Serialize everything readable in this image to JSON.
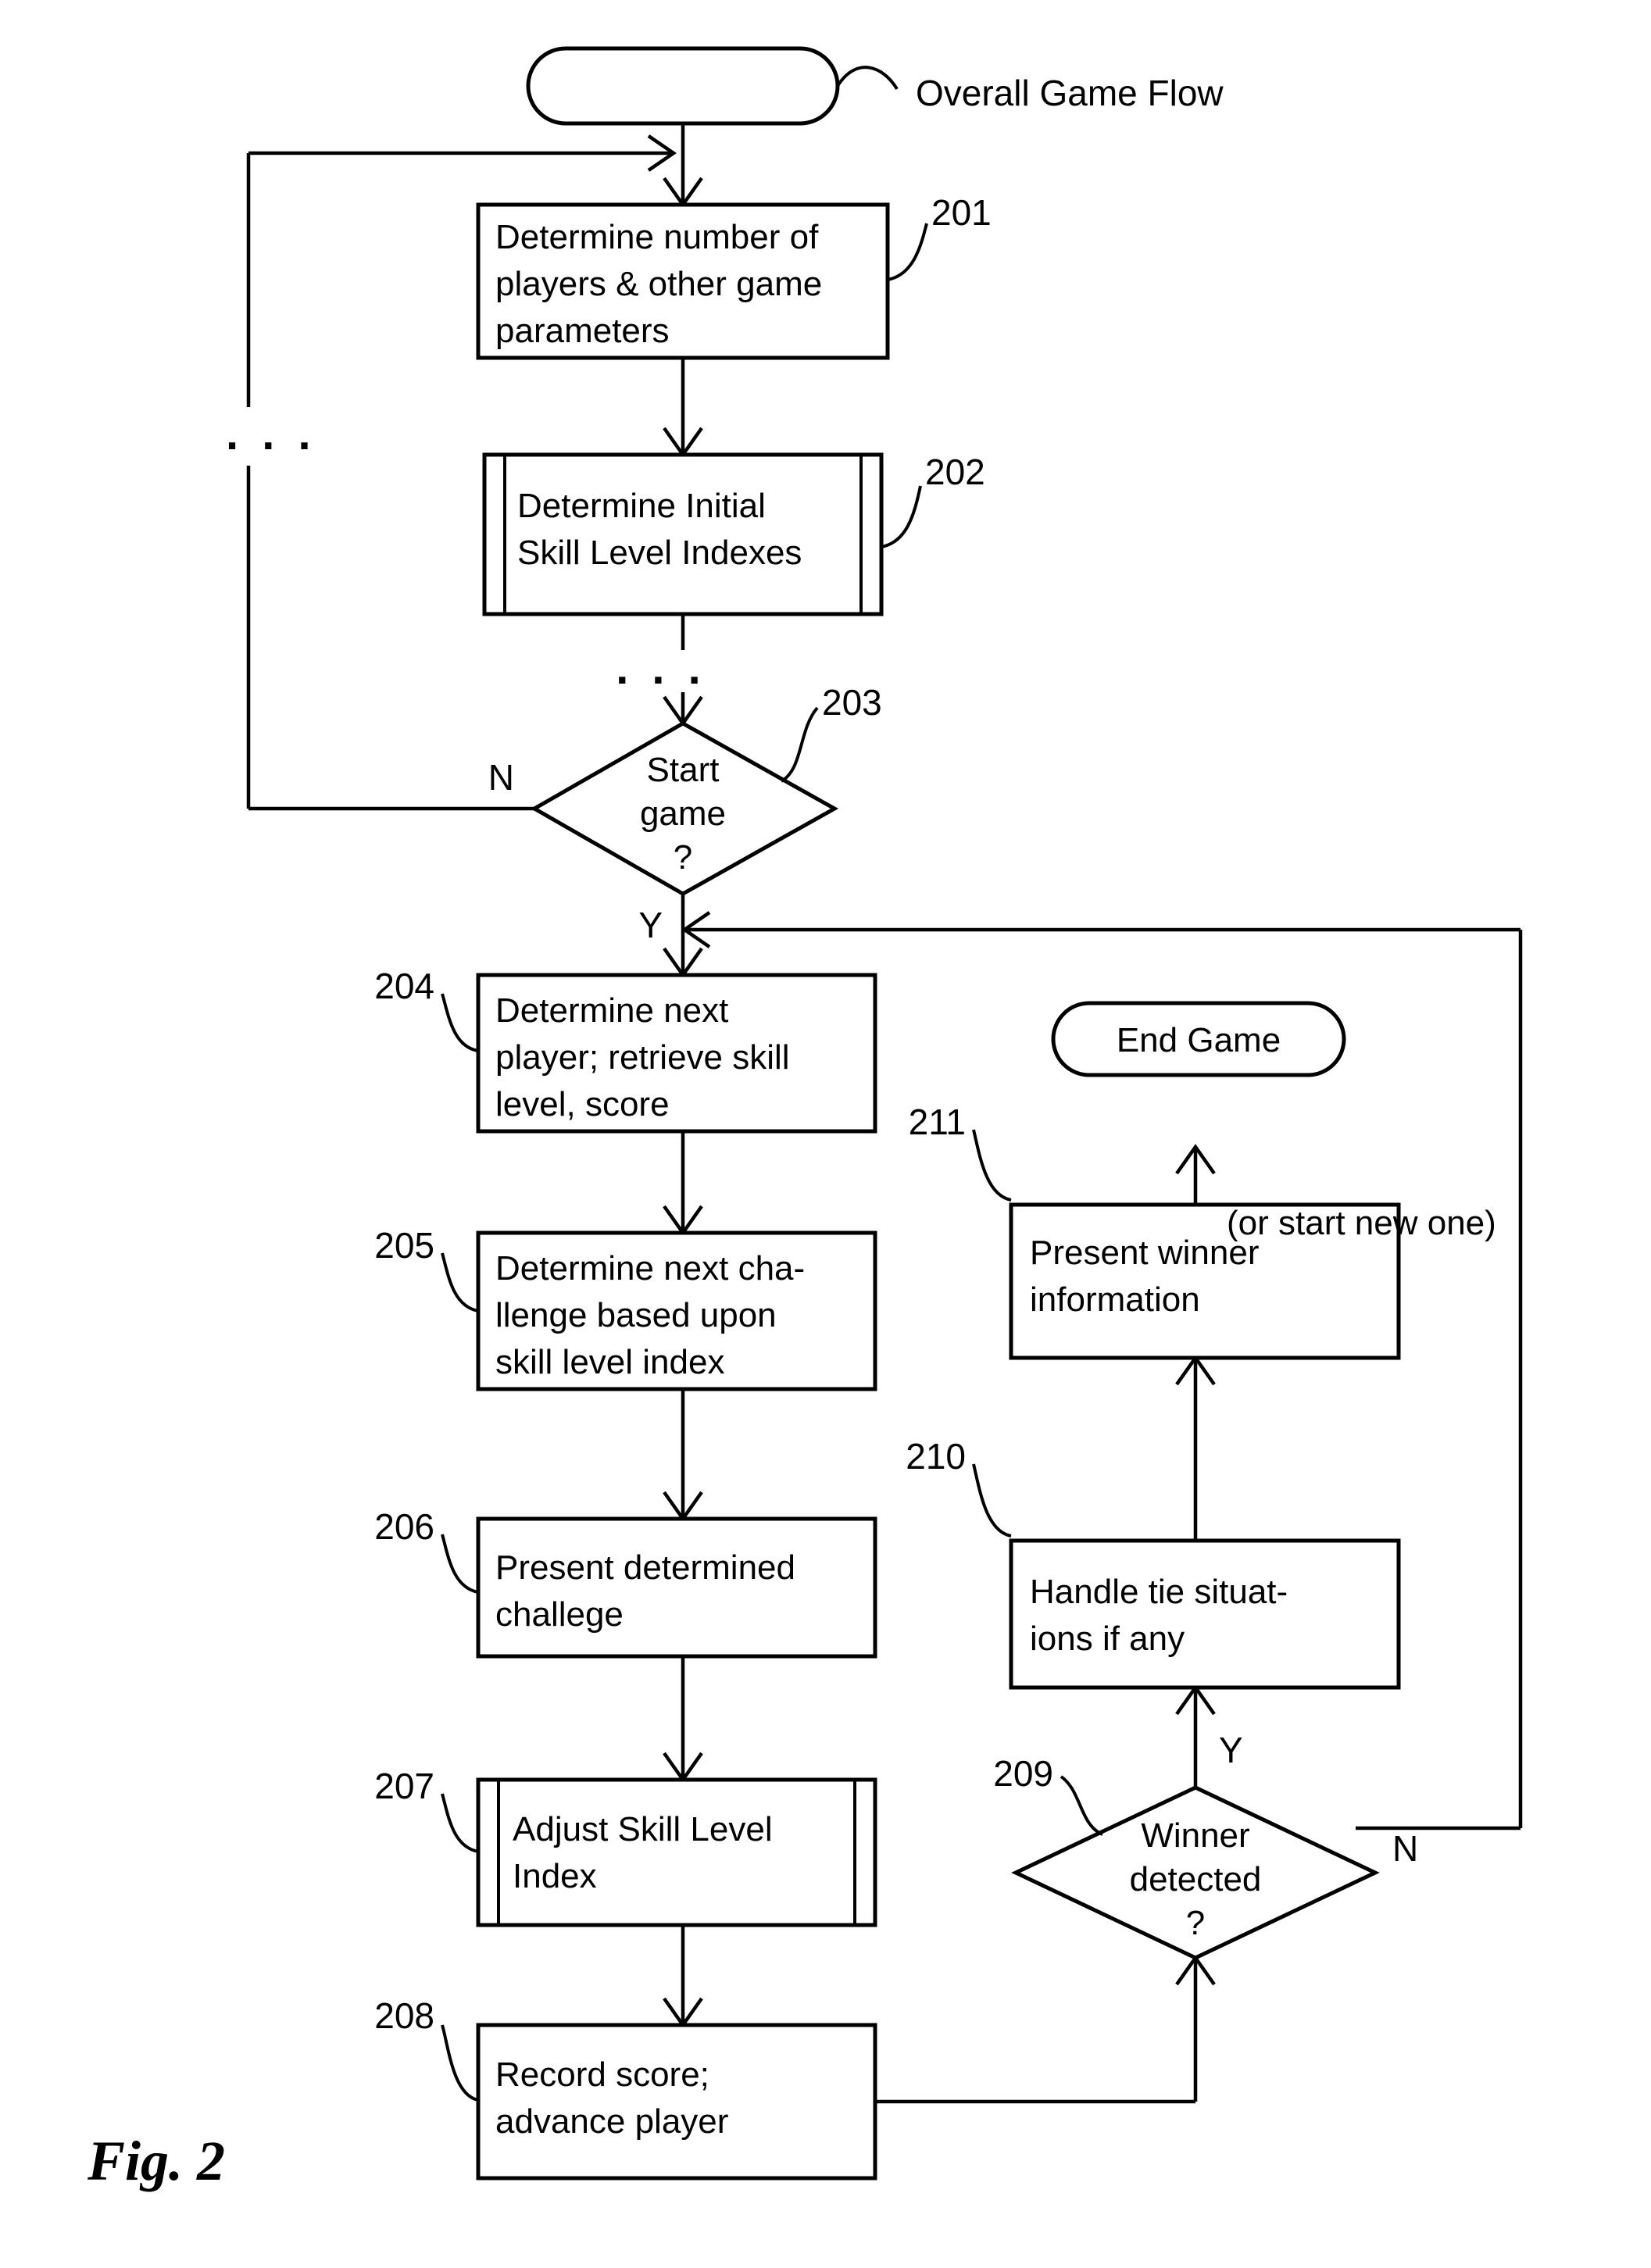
{
  "figure": {
    "label": "Fig. 2",
    "title": "Overall Game Flow"
  },
  "nodes": {
    "start": {
      "id": "start-terminator",
      "shape": "rounded-terminator",
      "text": ""
    },
    "end": {
      "id": "end-terminator",
      "shape": "rounded-terminator",
      "text": "End Game"
    },
    "s201": {
      "ref": "201",
      "shape": "process",
      "lines": [
        "Determine number of",
        "players & other game",
        "parameters"
      ]
    },
    "s202": {
      "ref": "202",
      "shape": "predefined-process",
      "lines": [
        "Determine Initial",
        "Skill Level Indexes"
      ]
    },
    "s203": {
      "ref": "203",
      "shape": "decision",
      "lines": [
        "Start",
        "game",
        "?"
      ],
      "yes_label": "Y",
      "no_label": "N"
    },
    "s204": {
      "ref": "204",
      "shape": "process",
      "lines": [
        "Determine next",
        "player; retrieve skill",
        "level, score"
      ]
    },
    "s205": {
      "ref": "205",
      "shape": "process",
      "lines": [
        "Determine next cha-",
        "llenge based upon",
        "skill level index"
      ]
    },
    "s206": {
      "ref": "206",
      "shape": "process",
      "lines": [
        "Present determined",
        "challege"
      ]
    },
    "s207": {
      "ref": "207",
      "shape": "predefined-process",
      "lines": [
        "Adjust Skill Level",
        "Index"
      ]
    },
    "s208": {
      "ref": "208",
      "shape": "process",
      "lines": [
        "Record score;",
        "advance player"
      ]
    },
    "s209": {
      "ref": "209",
      "shape": "decision",
      "lines": [
        "Winner",
        "detected",
        "?"
      ],
      "yes_label": "Y",
      "no_label": "N"
    },
    "s210": {
      "ref": "210",
      "shape": "process",
      "lines": [
        "Handle tie situat-",
        "ions if any"
      ]
    },
    "s211": {
      "ref": "211",
      "shape": "process",
      "lines": [
        "Present winner",
        "information"
      ]
    }
  },
  "annotations": {
    "or_start_new_one": "(or start new one)",
    "ellipsis_left": ". . .",
    "ellipsis_mid": ". . ."
  },
  "style": {
    "stroke": "#000000",
    "fill": "#ffffff",
    "background": "#ffffff"
  }
}
